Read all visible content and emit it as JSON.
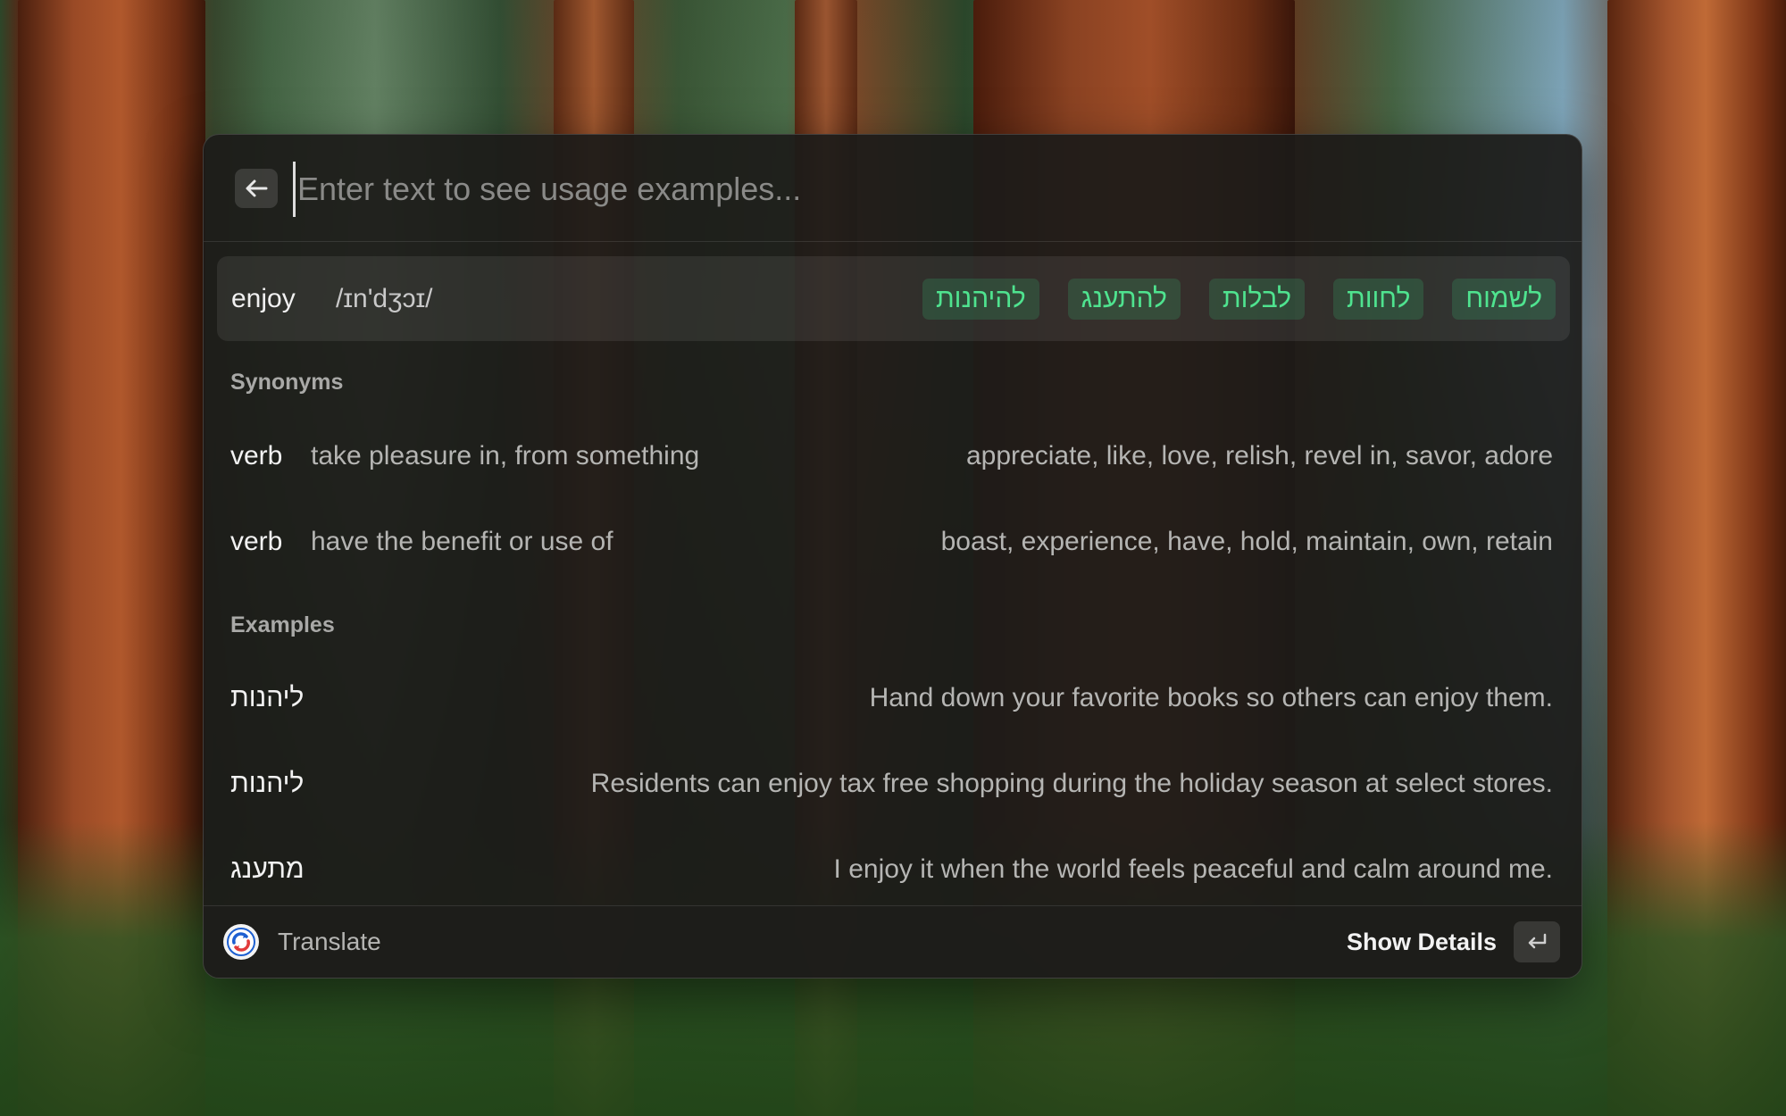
{
  "search": {
    "placeholder": "Enter text to see usage examples...",
    "value": ""
  },
  "entry": {
    "word": "enjoy",
    "phonetic": "/ɪn'dʒɔɪ/",
    "translations": [
      "להיהנות",
      "להתענג",
      "לבלות",
      "לחוות",
      "לשמוח"
    ]
  },
  "synonyms": {
    "heading": "Synonyms",
    "rows": [
      {
        "pos": "verb",
        "definition": "take pleasure in, from something",
        "words": "appreciate, like, love, relish, revel in, savor, adore"
      },
      {
        "pos": "verb",
        "definition": "have the benefit or use of",
        "words": "boast, experience, have, hold, maintain, own, retain"
      }
    ]
  },
  "examples": {
    "heading": "Examples",
    "rows": [
      {
        "word": "ליהנות",
        "sentence": "Hand down your favorite books so others can enjoy them."
      },
      {
        "word": "ליהנות",
        "sentence": "Residents can enjoy tax free shopping during the holiday season at select stores."
      },
      {
        "word": "מתענג",
        "sentence": "I enjoy it when the world feels peaceful and calm around me."
      }
    ]
  },
  "footer": {
    "app_name": "Translate",
    "action_label": "Show Details"
  },
  "icons": {
    "back": "arrow-left-icon",
    "app": "translate-app-icon",
    "enter": "return-key-icon"
  },
  "colors": {
    "chip_text": "#4fe38f",
    "chip_bg": "rgba(56,196,120,0.20)",
    "panel_bg": "rgba(28,27,25,0.93)"
  }
}
